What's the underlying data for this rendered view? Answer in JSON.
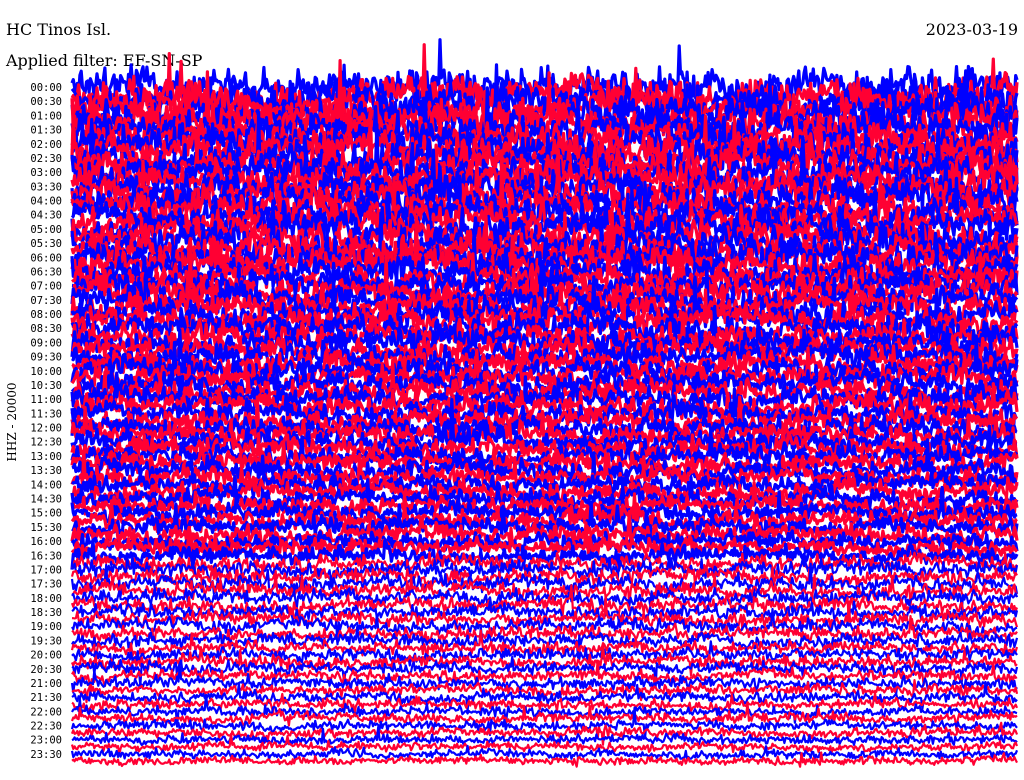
{
  "header": {
    "station": "HC Tinos Isl.",
    "date": "2023-03-19",
    "filter": "Applied filter: EF-SN-SP"
  },
  "chart_data": {
    "type": "line",
    "ylabel": "HHZ - 20000",
    "tick_labels": [
      "00:00",
      "00:30",
      "01:00",
      "01:30",
      "02:00",
      "02:30",
      "03:00",
      "03:30",
      "04:00",
      "04:30",
      "05:00",
      "05:30",
      "06:00",
      "06:30",
      "07:00",
      "07:30",
      "08:00",
      "08:30",
      "09:00",
      "09:30",
      "10:00",
      "10:30",
      "11:00",
      "11:30",
      "12:00",
      "12:30",
      "13:00",
      "13:30",
      "14:00",
      "14:30",
      "15:00",
      "15:30",
      "16:00",
      "16:30",
      "17:00",
      "17:30",
      "18:00",
      "18:30",
      "19:00",
      "19:30",
      "20:00",
      "20:30",
      "21:00",
      "21:30",
      "22:00",
      "22:30",
      "23:00",
      "23:30"
    ],
    "series_colors": [
      "#0000ff",
      "#ff0033"
    ],
    "rows_per_label": 1,
    "trace_minutes": 15,
    "grid": false
  }
}
